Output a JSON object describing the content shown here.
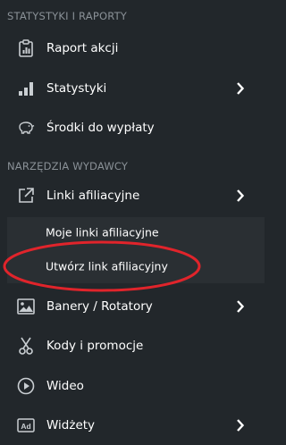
{
  "sections": {
    "reports_header": "STATYSTYKI I RAPORTY",
    "publisher_tools_header": "NARZĘDZIA WYDAWCY"
  },
  "items": {
    "raport_akcji": {
      "label": "Raport akcji",
      "icon": "clipboard-icon"
    },
    "statystyki": {
      "label": "Statystyki",
      "icon": "bar-chart-icon",
      "has_submenu": true
    },
    "srodki": {
      "label": "Środki do wypłaty",
      "icon": "piggy-bank-icon"
    },
    "linki": {
      "label": "Linki afiliacyjne",
      "icon": "external-link-icon",
      "has_submenu": true,
      "expanded": true
    },
    "banery": {
      "label": "Banery / Rotatory",
      "icon": "image-icon",
      "has_submenu": true
    },
    "kody": {
      "label": "Kody i promocje",
      "icon": "scissors-icon"
    },
    "wideo": {
      "label": "Wideo",
      "icon": "play-circle-icon"
    },
    "widzety": {
      "label": "Widżety",
      "icon": "ad-icon",
      "has_submenu": true
    }
  },
  "submenu": {
    "moje_linki": "Moje linki afiliacyjne",
    "utworz_link": "Utwórz link afiliacyjny"
  },
  "colors": {
    "background": "#22272b",
    "submenu_background": "#2a2f33",
    "text": "#ffffff",
    "header_text": "#8a9197",
    "annotation": "#e0242b"
  }
}
